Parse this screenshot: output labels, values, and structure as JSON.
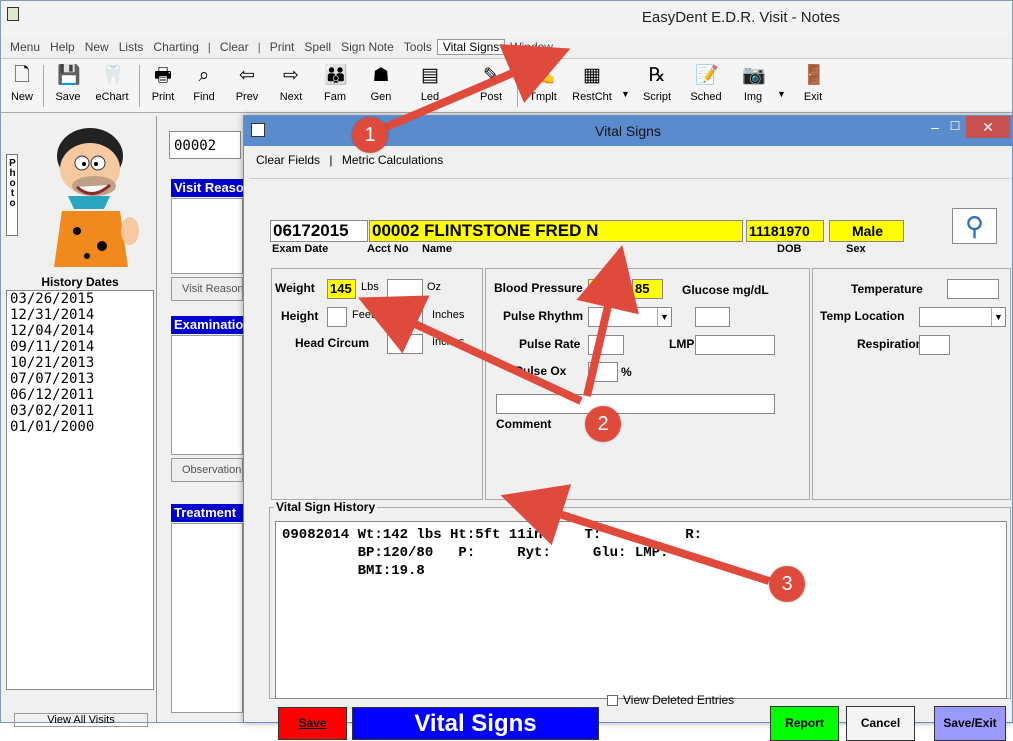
{
  "app": {
    "title": "EasyDent E.D.R. Visit - Notes"
  },
  "menu": [
    "Menu",
    "Help",
    "New",
    "Lists",
    "Charting",
    "|",
    "Clear",
    "|",
    "Print",
    "Spell",
    "Sign Note",
    "Tools",
    "Vital Signs",
    "Window"
  ],
  "toolbar": [
    {
      "label": "New",
      "icon": "new-document-icon"
    },
    {
      "label": "Save",
      "icon": "floppy-disk-icon"
    },
    {
      "label": "eChart",
      "icon": "echart-icon"
    },
    {
      "label": "Print",
      "icon": "printer-icon"
    },
    {
      "label": "Find",
      "icon": "binoculars-icon"
    },
    {
      "label": "Prev",
      "icon": "arrow-left-icon"
    },
    {
      "label": "Next",
      "icon": "arrow-right-icon"
    },
    {
      "label": "Fam",
      "icon": "family-icon"
    },
    {
      "label": "Gen",
      "icon": "genogram-icon"
    },
    {
      "label": "Led",
      "icon": "ledger-icon"
    },
    {
      "label": "Post",
      "icon": "pencil-icon"
    },
    {
      "label": "Tmplt",
      "icon": "template-icon"
    },
    {
      "label": "RestCht",
      "icon": "restorative-chart-icon"
    },
    {
      "label": "Script",
      "icon": "prescription-icon"
    },
    {
      "label": "Sched",
      "icon": "schedule-icon"
    },
    {
      "label": "Img",
      "icon": "camera-icon"
    },
    {
      "label": "Exit",
      "icon": "exit-door-icon"
    }
  ],
  "left": {
    "photo_tab": "Photo",
    "history_label": "History Dates",
    "history_dates": [
      "03/26/2015",
      "12/31/2014",
      "12/04/2014",
      "09/11/2014",
      "10/21/2013",
      "07/07/2013",
      "06/12/2011",
      "03/02/2011",
      "01/01/2000"
    ],
    "view_all": "View All Visits"
  },
  "mid": {
    "acct": "00002",
    "visit_header": "Visit Reason",
    "visit_button": "Visit Reason",
    "exam_header": "Examination",
    "obs_button": "Observation",
    "treat_header": "Treatment"
  },
  "dialog": {
    "title": "Vital Signs",
    "menu": {
      "clear": "Clear Fields",
      "sep": "|",
      "metric": "Metric Calculations"
    },
    "patient": {
      "exam_date": "06172015",
      "acct": "00002",
      "name": "FLINTSTONE FRED N",
      "dob": "11181970",
      "sex": "Male",
      "labels": {
        "exam_date": "Exam Date",
        "acct": "Acct No",
        "name": "Name",
        "dob": "DOB",
        "sex": "Sex"
      }
    },
    "measure": {
      "weight_label": "Weight",
      "weight": "145",
      "lbs": "Lbs",
      "oz_val": "",
      "oz": "Oz",
      "height_label": "Height",
      "feet": "Feet",
      "inches": "Inches",
      "head_label": "Head Circum",
      "head_unit": "Inches"
    },
    "pressure": {
      "bp_label": "Blood Pressure",
      "systolic": "125",
      "slash": "/",
      "diastolic": "85",
      "glucose_label": "Glucose mg/dL",
      "rhythm_label": "Pulse Rhythm",
      "rate_label": "Pulse Rate",
      "lmp_label": "LMP",
      "ox_label": "Pulse Ox",
      "percent": "%",
      "comment_label": "Comment"
    },
    "temp": {
      "temp_label": "Temperature",
      "loc_label": "Temp Location",
      "resp_label": "Respirations"
    },
    "history": {
      "title": "Vital Sign History",
      "text": "09082014 Wt:142 lbs Ht:5ft 11in     T:          R:\n         BP:120/80   P:     Ryt:     Glu: LMP:\n         BMI:19.8"
    },
    "buttons": {
      "save": "Save",
      "banner": "Vital Signs",
      "view_deleted": "View Deleted Entries",
      "report": "Report",
      "cancel": "Cancel",
      "save_exit": "Save/Exit"
    }
  },
  "callouts": [
    "1",
    "2",
    "3"
  ],
  "colors": {
    "highlight_yellow": "#ffff00",
    "header_blue": "#0000cc",
    "callout_red": "#e04a3c"
  }
}
